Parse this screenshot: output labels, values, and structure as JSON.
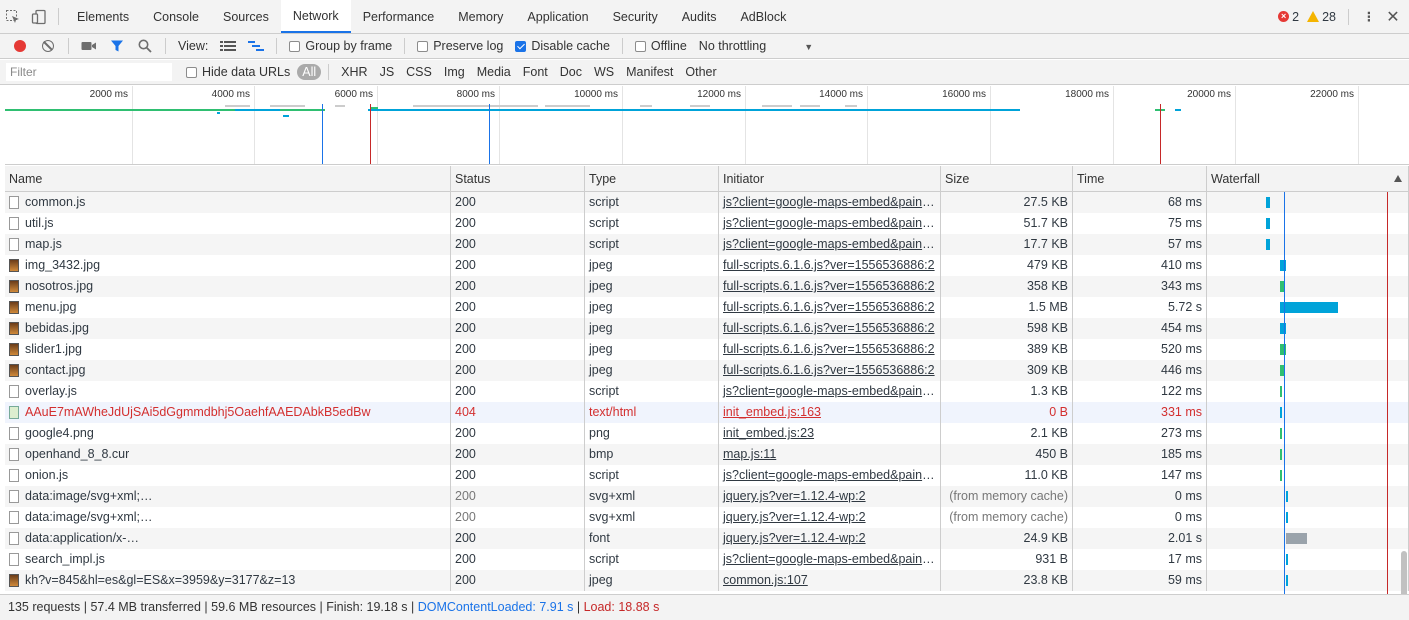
{
  "tabs": [
    "Elements",
    "Console",
    "Sources",
    "Network",
    "Performance",
    "Memory",
    "Application",
    "Security",
    "Audits",
    "AdBlock"
  ],
  "active_tab": "Network",
  "badges": {
    "errors": "2",
    "warnings": "28"
  },
  "toolbar": {
    "view_label": "View:",
    "group_by_frame": "Group by frame",
    "preserve_log": "Preserve log",
    "disable_cache": "Disable cache",
    "offline": "Offline",
    "throttling": "No throttling"
  },
  "filter": {
    "placeholder": "Filter",
    "hide_data_urls": "Hide data URLs",
    "types": [
      "All",
      "XHR",
      "JS",
      "CSS",
      "Img",
      "Media",
      "Font",
      "Doc",
      "WS",
      "Manifest",
      "Other"
    ],
    "active_type": "All"
  },
  "overview": {
    "tick_labels": [
      "2000 ms",
      "4000 ms",
      "6000 ms",
      "8000 ms",
      "10000 ms",
      "12000 ms",
      "14000 ms",
      "16000 ms",
      "18000 ms",
      "20000 ms",
      "22000 ms"
    ]
  },
  "columns": [
    "Name",
    "Status",
    "Type",
    "Initiator",
    "Size",
    "Time",
    "Waterfall"
  ],
  "rows": [
    {
      "name": "common.js",
      "status": "200",
      "type": "script",
      "initiator": "js?client=google-maps-embed&paint…",
      "size": "27.5 KB",
      "time": "68 ms",
      "icon": "file",
      "wf": [
        0.26,
        0.02,
        "#00a3d9"
      ]
    },
    {
      "name": "util.js",
      "status": "200",
      "type": "script",
      "initiator": "js?client=google-maps-embed&paint…",
      "size": "51.7 KB",
      "time": "75 ms",
      "icon": "file",
      "wf": [
        0.26,
        0.02,
        "#00a3d9"
      ]
    },
    {
      "name": "map.js",
      "status": "200",
      "type": "script",
      "initiator": "js?client=google-maps-embed&paint…",
      "size": "17.7 KB",
      "time": "57 ms",
      "icon": "file",
      "wf": [
        0.26,
        0.02,
        "#00a3d9"
      ]
    },
    {
      "name": "img_3432.jpg",
      "status": "200",
      "type": "jpeg",
      "initiator": "full-scripts.6.1.6.js?ver=1556536886:2",
      "size": "479 KB",
      "time": "410 ms",
      "icon": "img",
      "wf": [
        0.34,
        0.03,
        "#00a3d9"
      ]
    },
    {
      "name": "nosotros.jpg",
      "status": "200",
      "type": "jpeg",
      "initiator": "full-scripts.6.1.6.js?ver=1556536886:2",
      "size": "358 KB",
      "time": "343 ms",
      "icon": "img",
      "wf": [
        0.34,
        0.02,
        "#2fbf71"
      ]
    },
    {
      "name": "menu.jpg",
      "status": "200",
      "type": "jpeg",
      "initiator": "full-scripts.6.1.6.js?ver=1556536886:2",
      "size": "1.5 MB",
      "time": "5.72 s",
      "icon": "img",
      "wf": [
        0.34,
        0.3,
        "#00a3d9"
      ]
    },
    {
      "name": "bebidas.jpg",
      "status": "200",
      "type": "jpeg",
      "initiator": "full-scripts.6.1.6.js?ver=1556536886:2",
      "size": "598 KB",
      "time": "454 ms",
      "icon": "img",
      "wf": [
        0.34,
        0.03,
        "#00a3d9"
      ]
    },
    {
      "name": "slider1.jpg",
      "status": "200",
      "type": "jpeg",
      "initiator": "full-scripts.6.1.6.js?ver=1556536886:2",
      "size": "389 KB",
      "time": "520 ms",
      "icon": "img",
      "wf": [
        0.34,
        0.03,
        "#2fbf71"
      ]
    },
    {
      "name": "contact.jpg",
      "status": "200",
      "type": "jpeg",
      "initiator": "full-scripts.6.1.6.js?ver=1556536886:2",
      "size": "309 KB",
      "time": "446 ms",
      "icon": "img",
      "wf": [
        0.34,
        0.02,
        "#2fbf71"
      ]
    },
    {
      "name": "overlay.js",
      "status": "200",
      "type": "script",
      "initiator": "js?client=google-maps-embed&paint…",
      "size": "1.3 KB",
      "time": "122 ms",
      "icon": "file",
      "wf": [
        0.34,
        0.01,
        "#2fbf71"
      ]
    },
    {
      "name": "AAuE7mAWheJdUjSAi5dGgmmdbhj5OaehfAAEDAbkB5edBw",
      "status": "404",
      "type": "text/html",
      "initiator": "init_embed.js:163",
      "size": "0 B",
      "time": "331 ms",
      "icon": "err",
      "err": true,
      "wf": [
        0.34,
        0.01,
        "#00a3d9"
      ]
    },
    {
      "name": "google4.png",
      "status": "200",
      "type": "png",
      "initiator": "init_embed.js:23",
      "size": "2.1 KB",
      "time": "273 ms",
      "icon": "file",
      "wf": [
        0.34,
        0.01,
        "#2fbf71"
      ]
    },
    {
      "name": "openhand_8_8.cur",
      "status": "200",
      "type": "bmp",
      "initiator": "map.js:11",
      "size": "450 B",
      "time": "185 ms",
      "icon": "file",
      "wf": [
        0.34,
        0.01,
        "#2fbf71"
      ]
    },
    {
      "name": "onion.js",
      "status": "200",
      "type": "script",
      "initiator": "js?client=google-maps-embed&paint…",
      "size": "11.0 KB",
      "time": "147 ms",
      "icon": "file",
      "wf": [
        0.34,
        0.01,
        "#2fbf71"
      ]
    },
    {
      "name": "data:image/svg+xml;…",
      "status": "200",
      "type": "svg+xml",
      "initiator": "jquery.js?ver=1.12.4-wp:2",
      "size": "(from memory cache)",
      "time": "0 ms",
      "icon": "file",
      "gray": true,
      "wf": [
        0.37,
        0.01,
        "#00a3d9"
      ]
    },
    {
      "name": "data:image/svg+xml;…",
      "status": "200",
      "type": "svg+xml",
      "initiator": "jquery.js?ver=1.12.4-wp:2",
      "size": "(from memory cache)",
      "time": "0 ms",
      "icon": "file",
      "gray": true,
      "wf": [
        0.37,
        0.01,
        "#00a3d9"
      ]
    },
    {
      "name": "data:application/x-…",
      "status": "200",
      "type": "font",
      "initiator": "jquery.js?ver=1.12.4-wp:2",
      "size": "24.9 KB",
      "time": "2.01 s",
      "icon": "file",
      "wf": [
        0.37,
        0.11,
        "#9aa3ab"
      ]
    },
    {
      "name": "search_impl.js",
      "status": "200",
      "type": "script",
      "initiator": "js?client=google-maps-embed&paint…",
      "size": "931 B",
      "time": "17 ms",
      "icon": "file",
      "wf": [
        0.37,
        0.01,
        "#00a3d9"
      ]
    },
    {
      "name": "kh?v=845&hl=es&gl=ES&x=3959&y=3177&z=13",
      "status": "200",
      "type": "jpeg",
      "initiator": "common.js:107",
      "size": "23.8 KB",
      "time": "59 ms",
      "icon": "img",
      "wf": [
        0.37,
        0.01,
        "#00a3d9"
      ]
    }
  ],
  "status": {
    "summary": "135 requests | 57.4 MB transferred | 59.6 MB resources | Finish: 19.18 s | ",
    "dcl": "DOMContentLoaded: 7.91 s",
    "sep": " | ",
    "load": "Load: 18.88 s"
  },
  "colors": {
    "accent": "#1a73e8",
    "error": "#d32f2f",
    "dcl_line": "#1a73e8",
    "load_line": "#c62828",
    "wf_blue": "#00a3d9",
    "wf_green": "#2fbf71"
  }
}
